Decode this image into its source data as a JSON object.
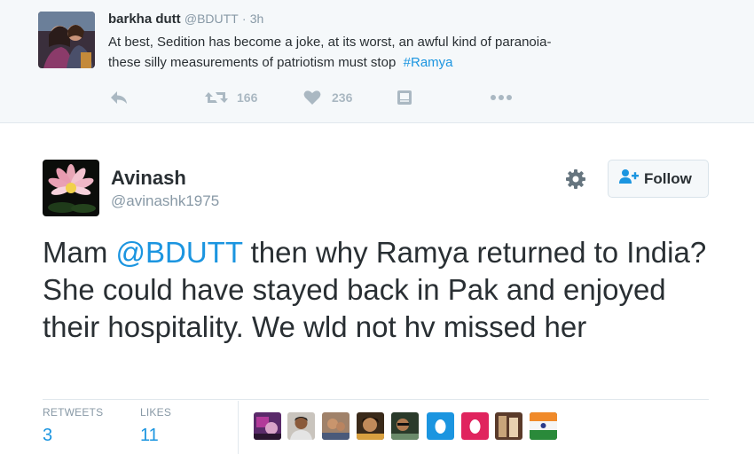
{
  "parent_tweet": {
    "name": "barkha dutt",
    "handle": "@BDUTT",
    "dot": "·",
    "time": "3h",
    "text_line1": "At best, Sedition has become a joke, at its worst, an awful kind of paranoia-",
    "text_line2_plain": "these silly measurements of patriotism must stop",
    "hashtag": "#Ramya",
    "retweet_count": "166",
    "like_count": "236",
    "icons": [
      "reply-icon",
      "retweet-icon",
      "heart-icon",
      "media-icon",
      "more-icon"
    ]
  },
  "tweet": {
    "name": "Avinash",
    "handle": "@avinashk1975",
    "text_before": "Mam ",
    "mention": "@BDUTT",
    "text_after": " then why Ramya returned to India? She could have stayed back in Pak and enjoyed their hospitality. We wld not hv missed her",
    "follow_label": "Follow"
  },
  "stats": {
    "retweets_label": "RETWEETS",
    "retweets_value": "3",
    "likes_label": "LIKES",
    "likes_value": "11"
  },
  "colors": {
    "link": "#1b95e0",
    "muted": "#8899a6",
    "action": "#aab8c2",
    "text": "#292f33"
  }
}
